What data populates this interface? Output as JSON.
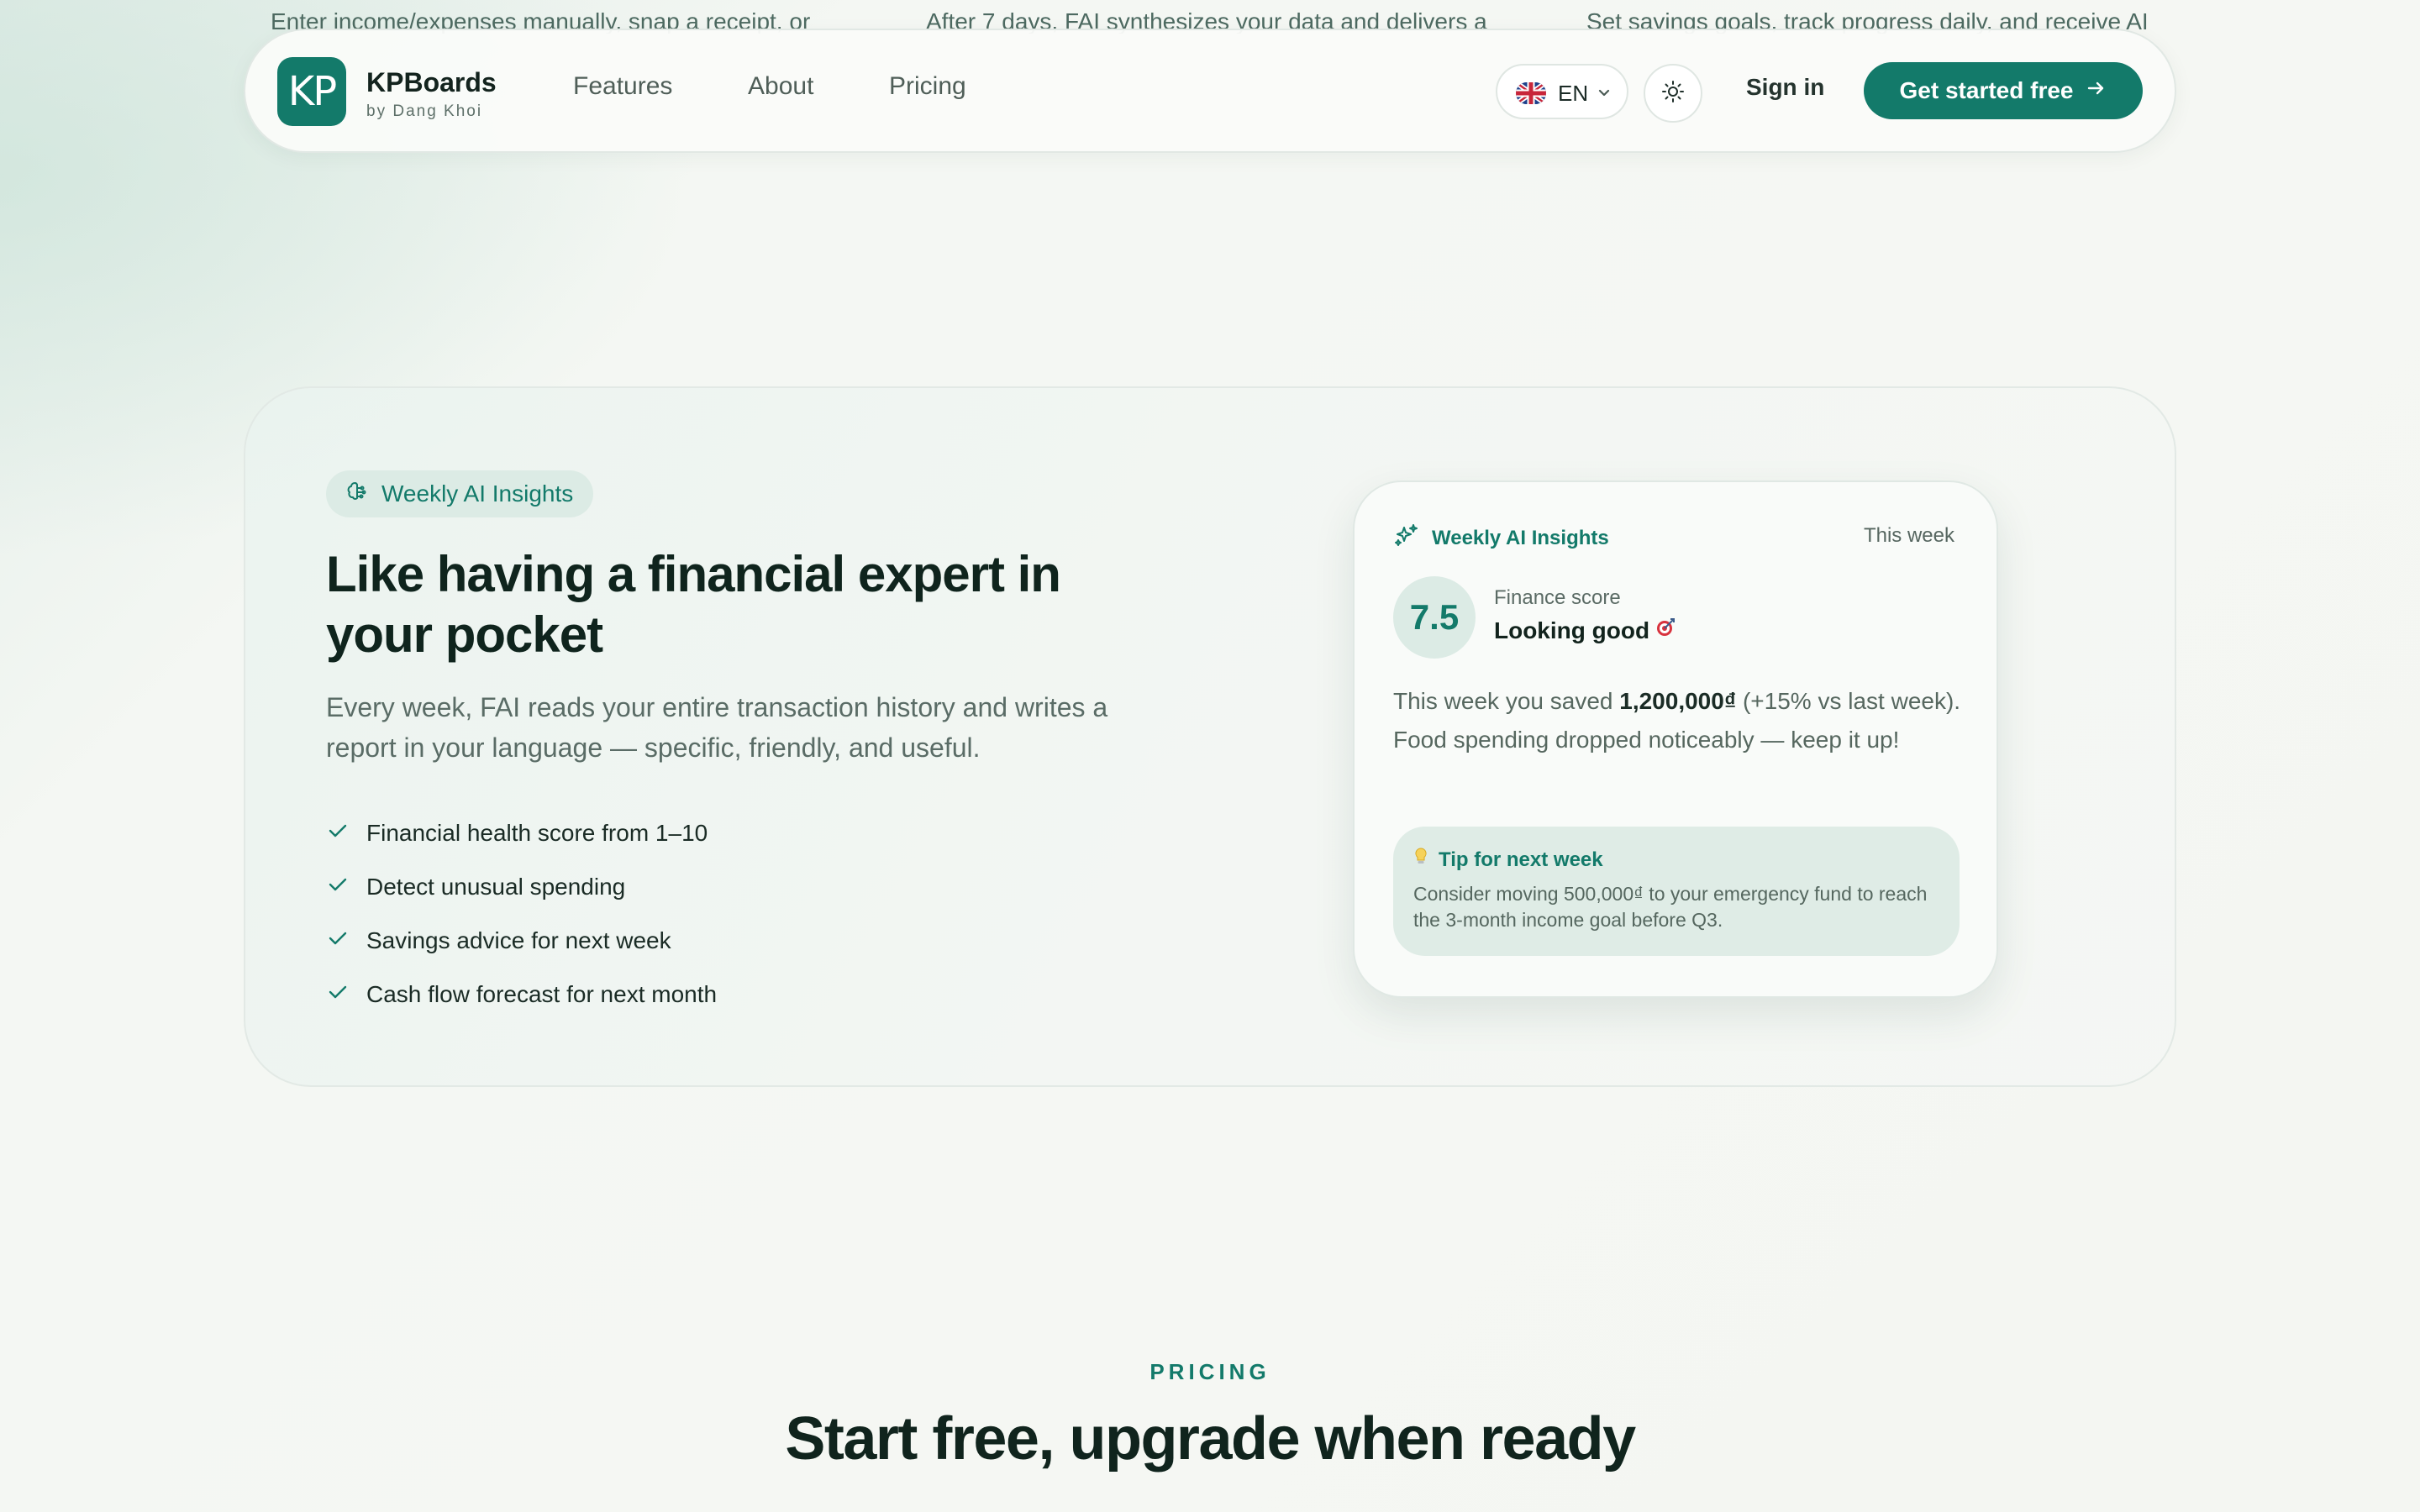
{
  "peek": {
    "col1": "Enter income/expenses manually, snap a receipt, or",
    "col2": "After 7 days, FAI synthesizes your data and delivers a",
    "col3": "Set savings goals, track progress daily, and receive AI"
  },
  "header": {
    "logo_text": "KP",
    "brand_name": "KPBoards",
    "brand_sub": "by Dang Khoi",
    "nav": [
      {
        "label": "Features"
      },
      {
        "label": "About"
      },
      {
        "label": "Pricing"
      }
    ],
    "language": "EN",
    "language_icon": "uk-flag-icon",
    "theme_icon": "sun-icon",
    "sign_in": "Sign in",
    "cta": "Get started free",
    "cta_icon": "arrow-right-icon"
  },
  "feature": {
    "pill_label": "Weekly AI Insights",
    "pill_icon": "brain-icon",
    "headline": "Like having a financial expert in your pocket",
    "description": "Every week, FAI reads your entire transaction history and writes a report in your language — specific, friendly, and useful.",
    "checklist": [
      "Financial health score from 1–10",
      "Detect unusual spending",
      "Savings advice for next week",
      "Cash flow forecast for next month"
    ],
    "card": {
      "icon": "sparkles-icon",
      "title": "Weekly AI Insights",
      "period": "This week",
      "score": "7.5",
      "score_label": "Finance score",
      "score_status": "Looking good",
      "status_icon": "target-icon",
      "body_pre": "This week you saved ",
      "body_amount": "1,200,000₫",
      "body_post": " (+15% vs last week). Food spending dropped noticeably — keep it up!",
      "tip_icon": "lightbulb-icon",
      "tip_title": "Tip for next week",
      "tip_text": "Consider moving 500,000₫ to your emergency fund to reach the 3-month income goal before Q3."
    }
  },
  "pricing": {
    "label": "PRICING",
    "title": "Start free, upgrade when ready"
  },
  "colors": {
    "accent": "#137a6a",
    "accent_soft": "#dcebe5",
    "heading": "#0f241d",
    "body": "#5a6c66"
  }
}
